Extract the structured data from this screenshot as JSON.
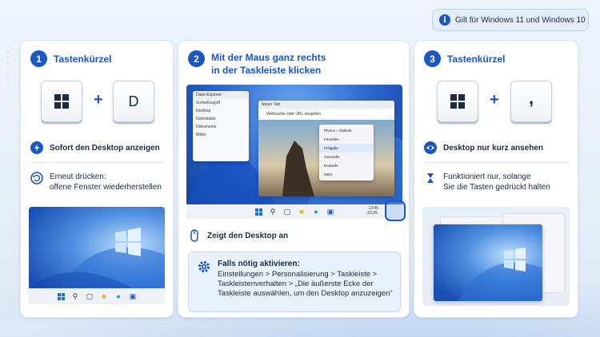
{
  "badge": {
    "icon": "info-icon",
    "text": "Gilt für Windows 11 und Windows 10"
  },
  "card1": {
    "number": "1",
    "title": "Tastenkürzel",
    "key1_icon": "windows-logo-icon",
    "plus": "+",
    "key2": "D",
    "item1": {
      "icon": "lightning-icon",
      "text": "Sofort den Desktop anzeigen"
    },
    "item2": {
      "icon": "undo-icon",
      "line1": "Erneut drücken:",
      "line2": "offene Fenster wiederherstellen"
    }
  },
  "card2": {
    "number": "2",
    "title_line1": "Mit der Maus ganz rechts",
    "title_line2": "in der Taskleiste klicken",
    "screenshot": {
      "explorer_title": "Datei-Explorer",
      "explorer_items": [
        "Schnellzugriff",
        "Desktop",
        "Downloads",
        "Dokumente",
        "Bilder"
      ],
      "browser_tab": "Neuer Tab",
      "browser_address": "Websuche oder URL eingeben",
      "menu_header": "Photos – Outlook",
      "menu_items": [
        "Favoriten",
        "Freigabe",
        "Generelle",
        "Entwürfe",
        "Mehr"
      ],
      "menu_selected": "Freigabe",
      "clock_time": "13:45",
      "clock_date": "23.05."
    },
    "item1": {
      "icon": "mouse-icon",
      "text": "Zeigt den Desktop an"
    },
    "info": {
      "icon": "gear-icon",
      "title": "Falls nötig aktivieren:",
      "text": "Einstellungen > Personalisierung > Taskleiste > Taskleistenverhalten > „Die äußerste Ecke der Taskleiste auswählen, um den Desktop anzuzeigen“"
    }
  },
  "card3": {
    "number": "3",
    "title": "Tastenkürzel",
    "key1_icon": "windows-logo-icon",
    "plus": "+",
    "key2": ",",
    "item1": {
      "icon": "eye-icon",
      "text": "Desktop nur kurz ansehen"
    },
    "item2": {
      "icon": "hourglass-icon",
      "line1": "Funktioniert nur, solange",
      "line2": "Sie die Tasten gedrückt halten"
    }
  },
  "colors": {
    "accent": "#1a56c4",
    "card": "#ffffff",
    "background": "#eef4fb"
  }
}
